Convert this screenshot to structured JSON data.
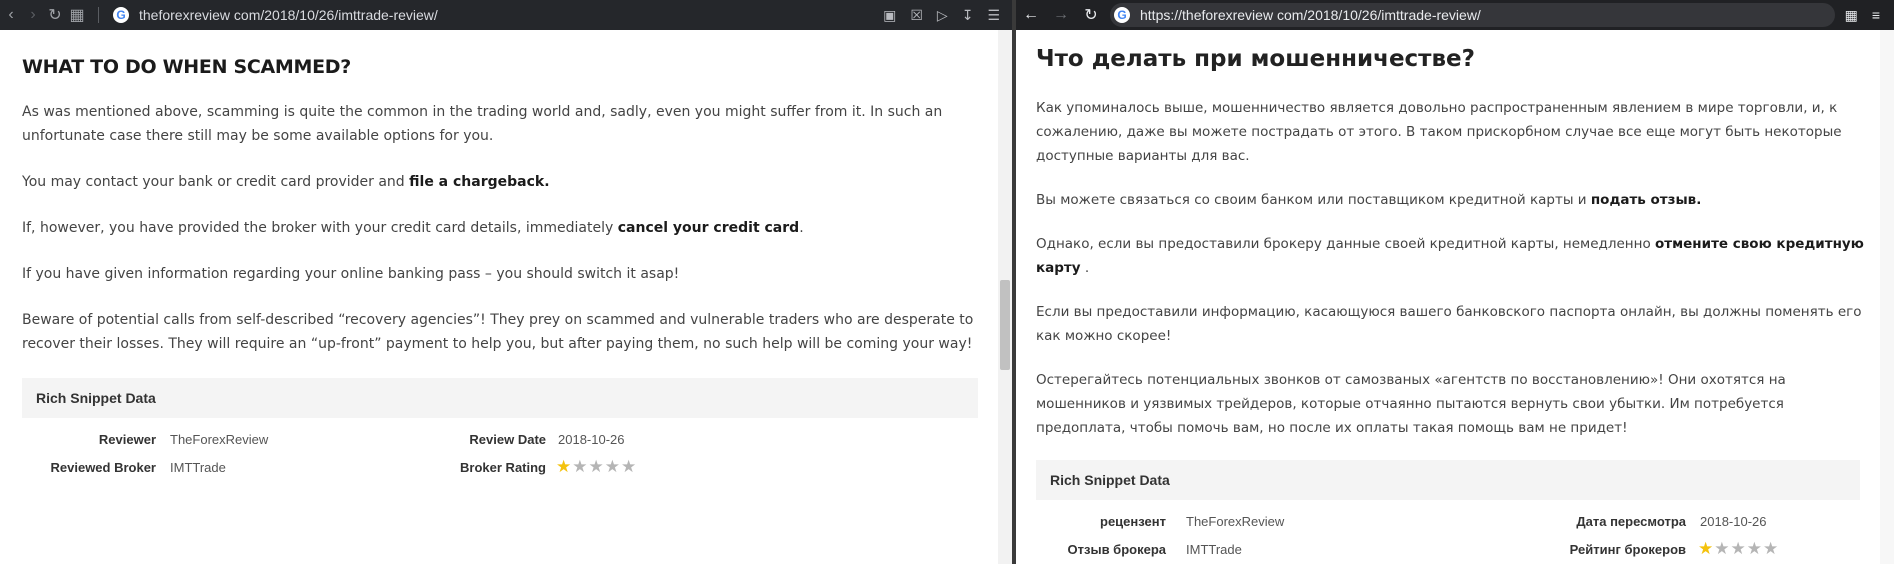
{
  "left": {
    "url": "theforexreview com/2018/10/26/imttrade-review/",
    "heading": "WHAT TO DO WHEN SCAMMED?",
    "p1": "As was mentioned above, scamming is quite the common in the trading world and, sadly, even you might suffer from it. In such an unfortunate case there still may be some available options for you.",
    "p2_pre": "You may contact your bank or credit card provider and ",
    "p2_bold": "file a chargeback.",
    "p3_pre": "If, however, you have provided the broker with your credit card details, immediately ",
    "p3_bold": "cancel your credit card",
    "p3_post": ".",
    "p4": "If you have given information regarding your online banking pass – you should switch it asap!",
    "p5": "Beware of potential calls from self-described “recovery agencies”! They prey on scammed and vulnerable traders who are desperate to recover their losses. They will require an “up-front” payment to help you, but after paying them, no such help will be coming your way!",
    "snippet": {
      "title": "Rich Snippet Data",
      "reviewer_label": "Reviewer",
      "reviewer_value": "TheForexReview",
      "date_label": "Review Date",
      "date_value": "2018-10-26",
      "broker_label": "Reviewed Broker",
      "broker_value": "IMTTrade",
      "rating_label": "Broker Rating",
      "rating": 1,
      "rating_max": 5
    }
  },
  "right": {
    "url": "https://theforexreview com/2018/10/26/imttrade-review/",
    "heading": "Что делать при мошенничестве?",
    "p1": "Как упоминалось выше, мошенничество является довольно распространенным явлением в мире торговли, и, к сожалению, даже вы можете пострадать от этого. В таком прискорбном случае все еще могут быть некоторые доступные варианты для вас.",
    "p2_pre": "Вы можете связаться со своим банком или поставщиком кредитной карты и ",
    "p2_bold": "подать отзыв.",
    "p3_pre": "Однако, если вы предоставили брокеру данные своей кредитной карты, немедленно ",
    "p3_bold": "отмените свою кредитную карту",
    "p3_post": " .",
    "p4": "Если вы предоставили информацию, касающуюся вашего банковского паспорта онлайн, вы должны поменять его как можно скорее!",
    "p5": "Остерегайтесь потенциальных звонков от самозваных «агентств по восстановлению»! Они охотятся на мошенников и уязвимых трейдеров, которые отчаянно пытаются вернуть свои убытки. Им потребуется предоплата, чтобы помочь вам, но после их оплаты такая помощь вам не придет!",
    "snippet": {
      "title": "Rich Snippet Data",
      "reviewer_label": "рецензент",
      "reviewer_value": "TheForexReview",
      "date_label": "Дата пересмотра",
      "date_value": "2018-10-26",
      "broker_label": "Отзыв брокера",
      "broker_value": "IMTTrade",
      "rating_label": "Рейтинг брокеров",
      "rating": 1,
      "rating_max": 5
    }
  }
}
